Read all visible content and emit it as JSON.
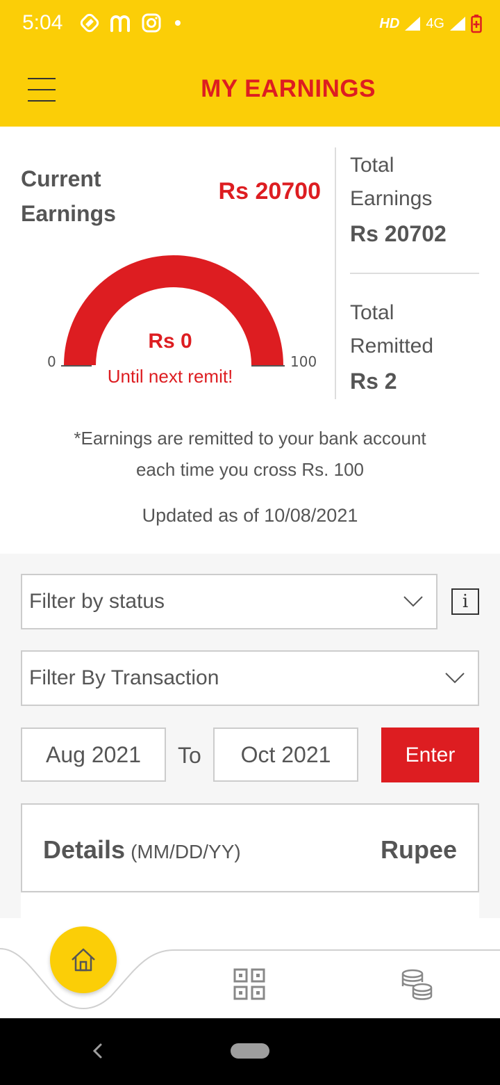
{
  "status_bar": {
    "time": "5:04",
    "left_icons": [
      "shazam-icon",
      "m-app-icon",
      "instagram-icon",
      "dot-icon"
    ],
    "network_hd": "HD",
    "network_4g": "4G"
  },
  "header": {
    "title": "MY EARNINGS"
  },
  "earnings": {
    "current_label_line1": "Current",
    "current_label_line2": "Earnings",
    "current_amount": "Rs 20700",
    "gauge": {
      "value_text": "Rs 0",
      "caption": "Until next remit!",
      "min_label": "0",
      "max_label": "100",
      "progress": 0
    },
    "total_earnings_line1": "Total",
    "total_earnings_line2": "Earnings",
    "total_earnings_amount": "Rs 20702",
    "total_remitted_line1": "Total",
    "total_remitted_line2": "Remitted",
    "total_remitted_amount": "Rs 2",
    "note_line1": "*Earnings are remitted to your bank account",
    "note_line2": "each time you cross Rs. 100",
    "updated": "Updated as of 10/08/2021"
  },
  "filters": {
    "status_placeholder": "Filter by status",
    "transaction_placeholder": "Filter By Transaction",
    "date_from": "Aug 2021",
    "to_label": "To",
    "date_to": "Oct 2021",
    "enter_label": "Enter"
  },
  "details": {
    "title": "Details",
    "subtitle": "(MM/DD/YY)",
    "rupee_label": "Rupee"
  },
  "colors": {
    "brand_yellow": "#FBCE07",
    "brand_red": "#DD1D21",
    "text_gray": "#555555"
  }
}
